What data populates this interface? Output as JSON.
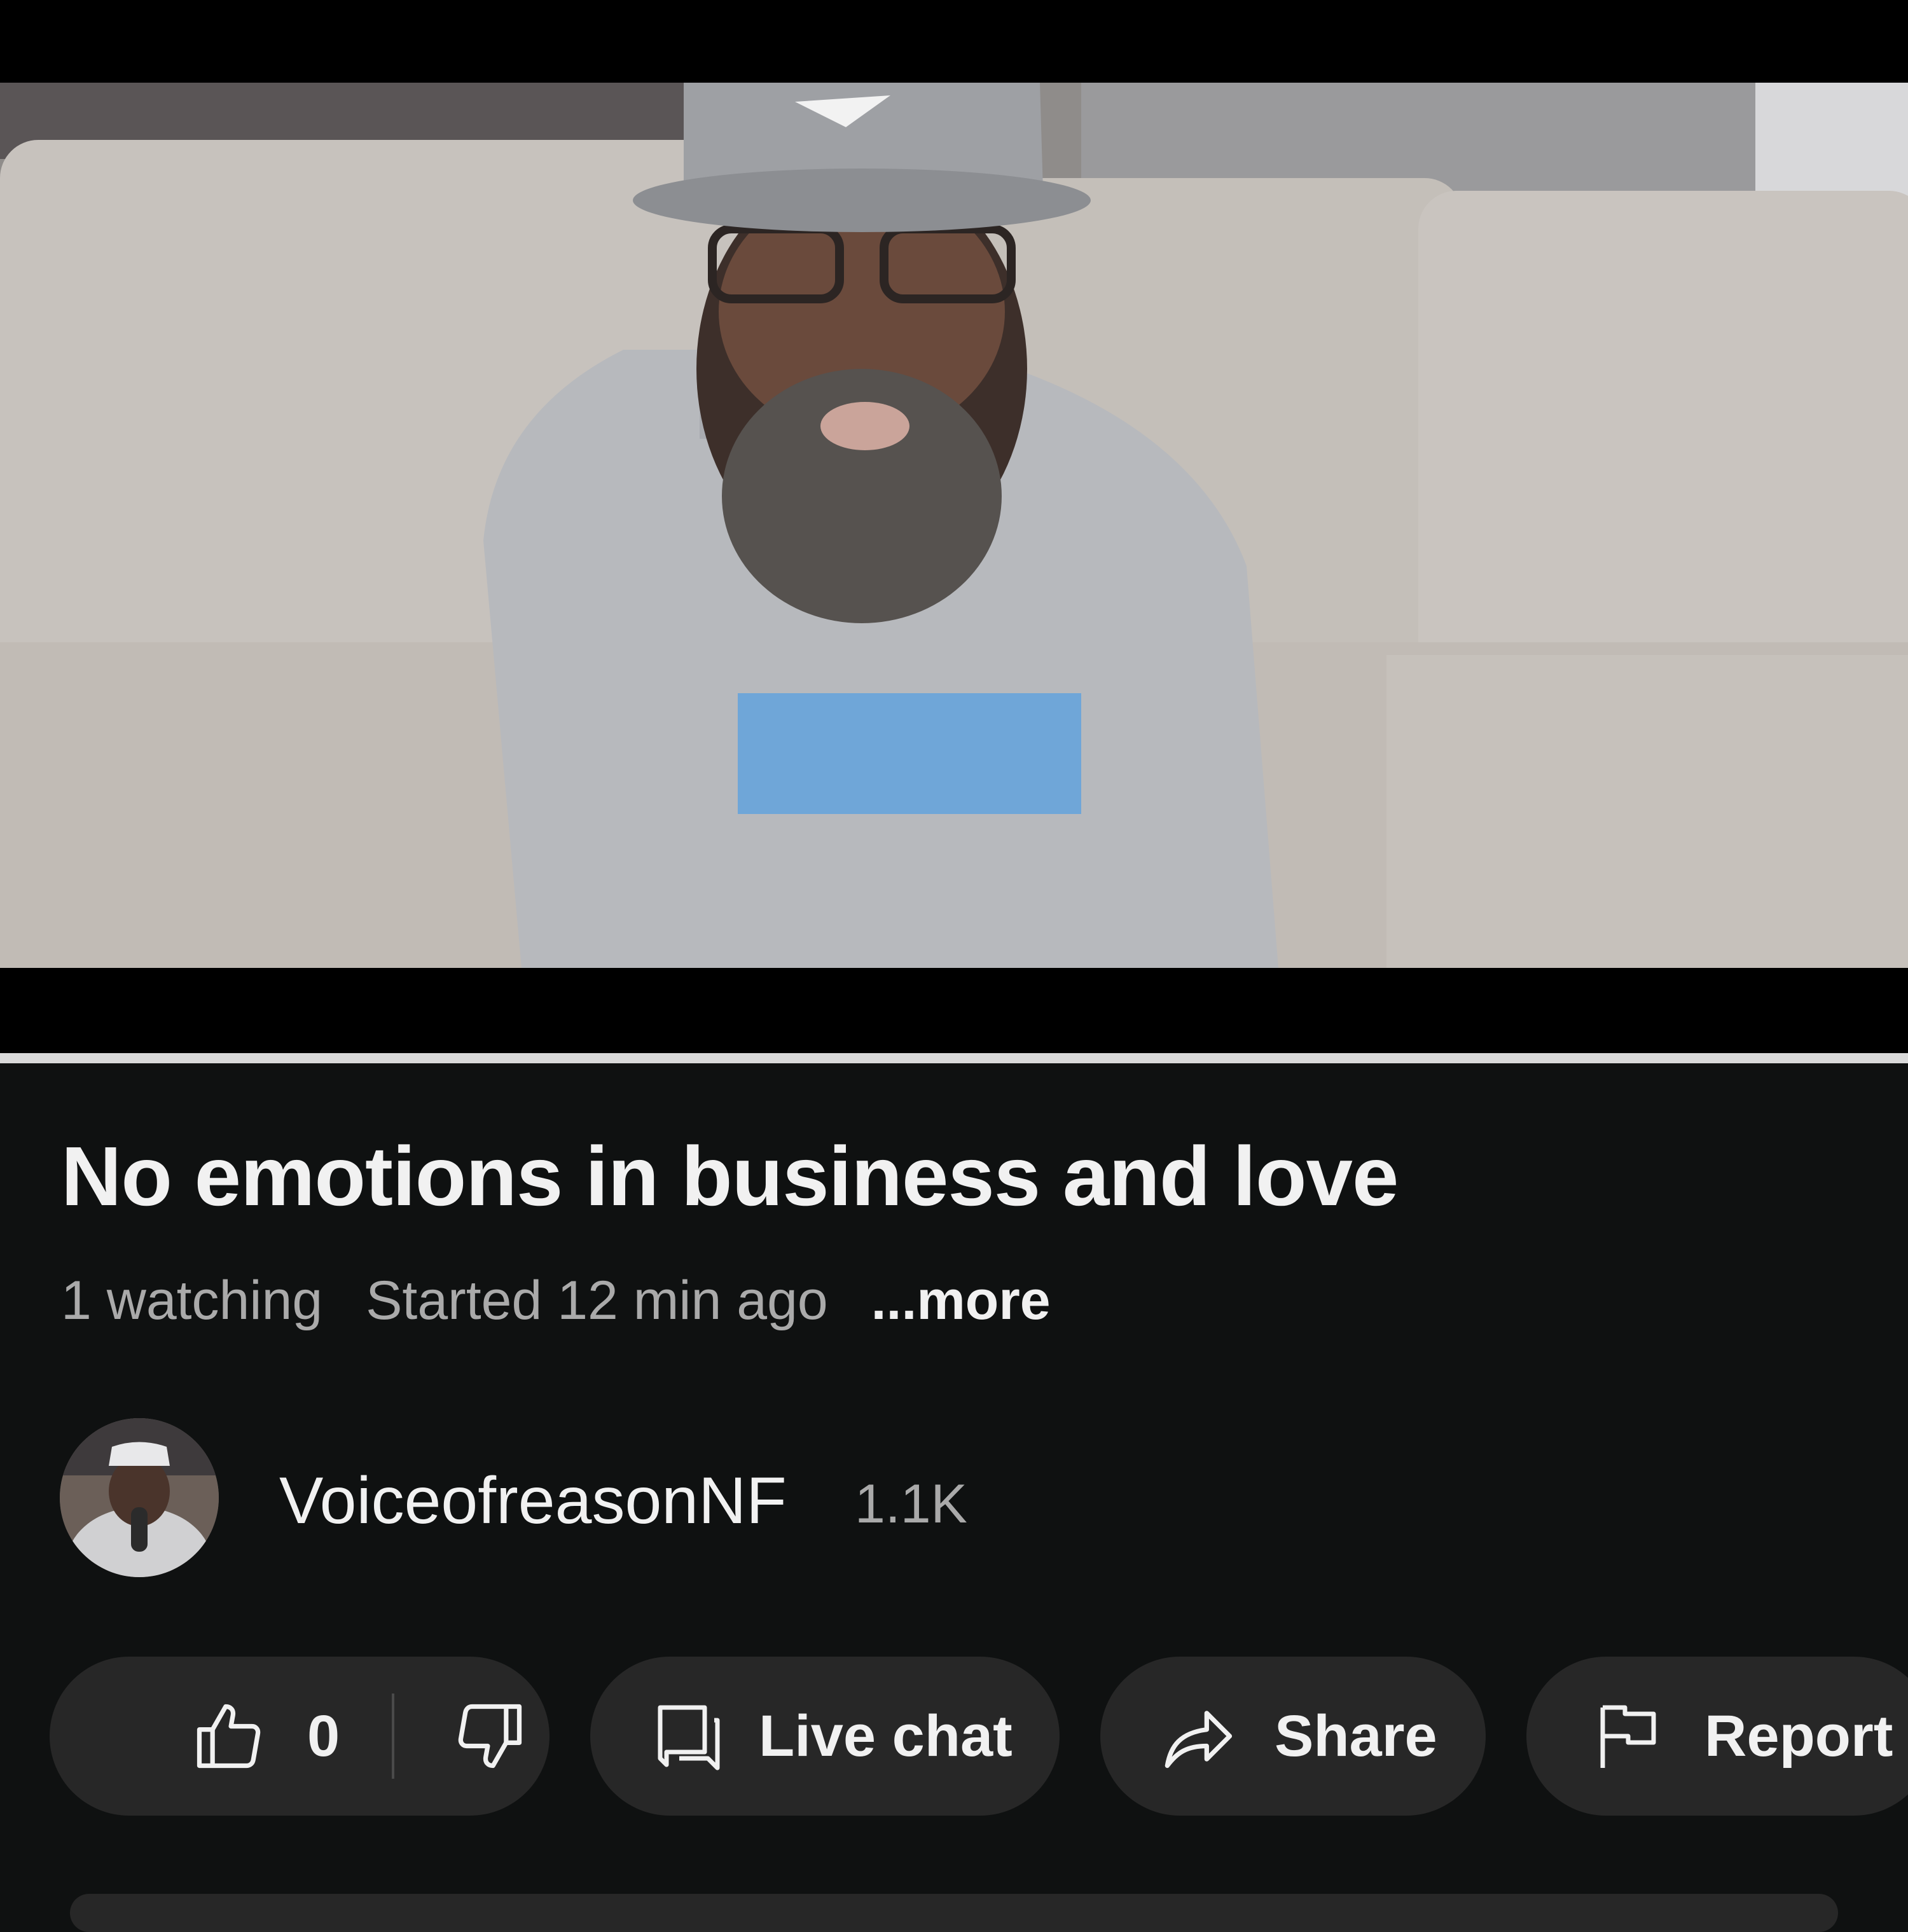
{
  "video": {
    "description_hidden": true
  },
  "title": "No emotions in business and love",
  "meta": {
    "watching": "1 watching",
    "started": "Started 12 min ago",
    "more": "...more"
  },
  "channel": {
    "name": "VoiceofreasonNF",
    "subscribers": "1.1K"
  },
  "actions": {
    "like_count": "0",
    "live_chat": "Live chat",
    "share": "Share",
    "report": "Report"
  },
  "icons": {
    "like": "thumbs-up-icon",
    "dislike": "thumbs-down-icon",
    "live_chat": "chat-bubble-icon",
    "share": "share-arrow-icon",
    "report": "flag-icon"
  },
  "colors": {
    "background": "#0f1111",
    "pill": "#272727",
    "text_primary": "#f1f1f1",
    "text_secondary": "#aaaaaa"
  }
}
